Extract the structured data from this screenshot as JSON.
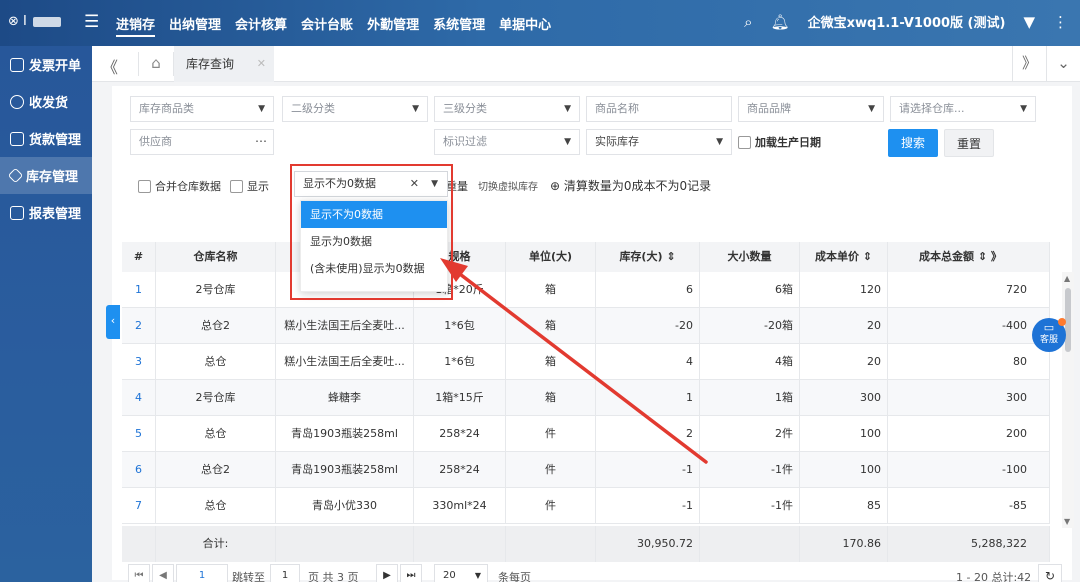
{
  "topbar": {
    "logo_text": "⊗ I",
    "menu": [
      "进销存",
      "出纳管理",
      "会计核算",
      "会计台账",
      "外勤管理",
      "系统管理",
      "单据中心"
    ],
    "active_menu": "进销存",
    "company": "企微宝xwq1.1-V1000版 (测试)"
  },
  "sidebar": {
    "items": [
      {
        "label": "发票开单",
        "icon": "invoice-icon"
      },
      {
        "label": "收发货",
        "icon": "shipping-icon"
      },
      {
        "label": "货款管理",
        "icon": "payment-icon"
      },
      {
        "label": "库存管理",
        "icon": "inventory-icon",
        "active": true
      },
      {
        "label": "报表管理",
        "icon": "report-icon"
      }
    ]
  },
  "tabs": {
    "active_tab": "库存查询"
  },
  "filters": {
    "category": "库存商品类",
    "category2": "二级分类",
    "category3": "三级分类",
    "product_name": "商品名称",
    "brand": "商品品牌",
    "warehouse": "请选择仓库...",
    "supplier": "供应商",
    "show_zero": "显示不为0数据",
    "tag_filter": "标识过滤",
    "stock_type": "实际库存",
    "production_date": "加载生产日期",
    "search": "搜索",
    "reset": "重置"
  },
  "dropdown": {
    "options": [
      "显示不为0数据",
      "显示为0数据",
      "(含未使用)显示为0数据"
    ],
    "selected": "显示不为0数据"
  },
  "toolbar": {
    "merge_warehouse": "合并仓库数据",
    "show_partial": "显示",
    "weight": "重量",
    "virtual_stock": "切换虚拟库存",
    "clear_zero": "⊕ 清算数量为0成本不为0记录"
  },
  "table": {
    "headers": [
      "#",
      "仓库名称",
      "",
      "规格",
      "单位(大)",
      "库存(大) ⇕",
      "大小数量",
      "成本单价 ⇕",
      "成本总金额 ⇕ 》"
    ],
    "rows": [
      [
        "1",
        "2号仓库",
        "",
        "1箱*20斤",
        "箱",
        "6",
        "6箱",
        "120",
        "720"
      ],
      [
        "2",
        "总仓2",
        "糕小生法国王后全麦吐...",
        "1*6包",
        "箱",
        "-20",
        "-20箱",
        "20",
        "-400"
      ],
      [
        "3",
        "总仓",
        "糕小生法国王后全麦吐...",
        "1*6包",
        "箱",
        "4",
        "4箱",
        "20",
        "80"
      ],
      [
        "4",
        "2号仓库",
        "蜂糖李",
        "1箱*15斤",
        "箱",
        "1",
        "1箱",
        "300",
        "300"
      ],
      [
        "5",
        "总仓",
        "青岛1903瓶装258ml",
        "258*24",
        "件",
        "2",
        "2件",
        "100",
        "200"
      ],
      [
        "6",
        "总仓2",
        "青岛1903瓶装258ml",
        "258*24",
        "件",
        "-1",
        "-1件",
        "100",
        "-100"
      ],
      [
        "7",
        "总仓",
        "青岛小优330",
        "330ml*24",
        "件",
        "-1",
        "-1件",
        "85",
        "-85"
      ]
    ],
    "total": [
      "",
      "合计:",
      "",
      "",
      "",
      "30,950.72",
      "",
      "170.86",
      "5,288,322"
    ]
  },
  "pager": {
    "current_page": "1",
    "goto_label": "跳转至",
    "goto_value": "1",
    "page_label": "页  共 3 页",
    "page_size": "20",
    "per_page": "条每页",
    "summary": "1 - 20 总计:42"
  },
  "kefu_label": "客服",
  "colors": {
    "primary": "#1e90f0",
    "highlight": "#e23a30",
    "topbar": "#2e6aa8"
  }
}
